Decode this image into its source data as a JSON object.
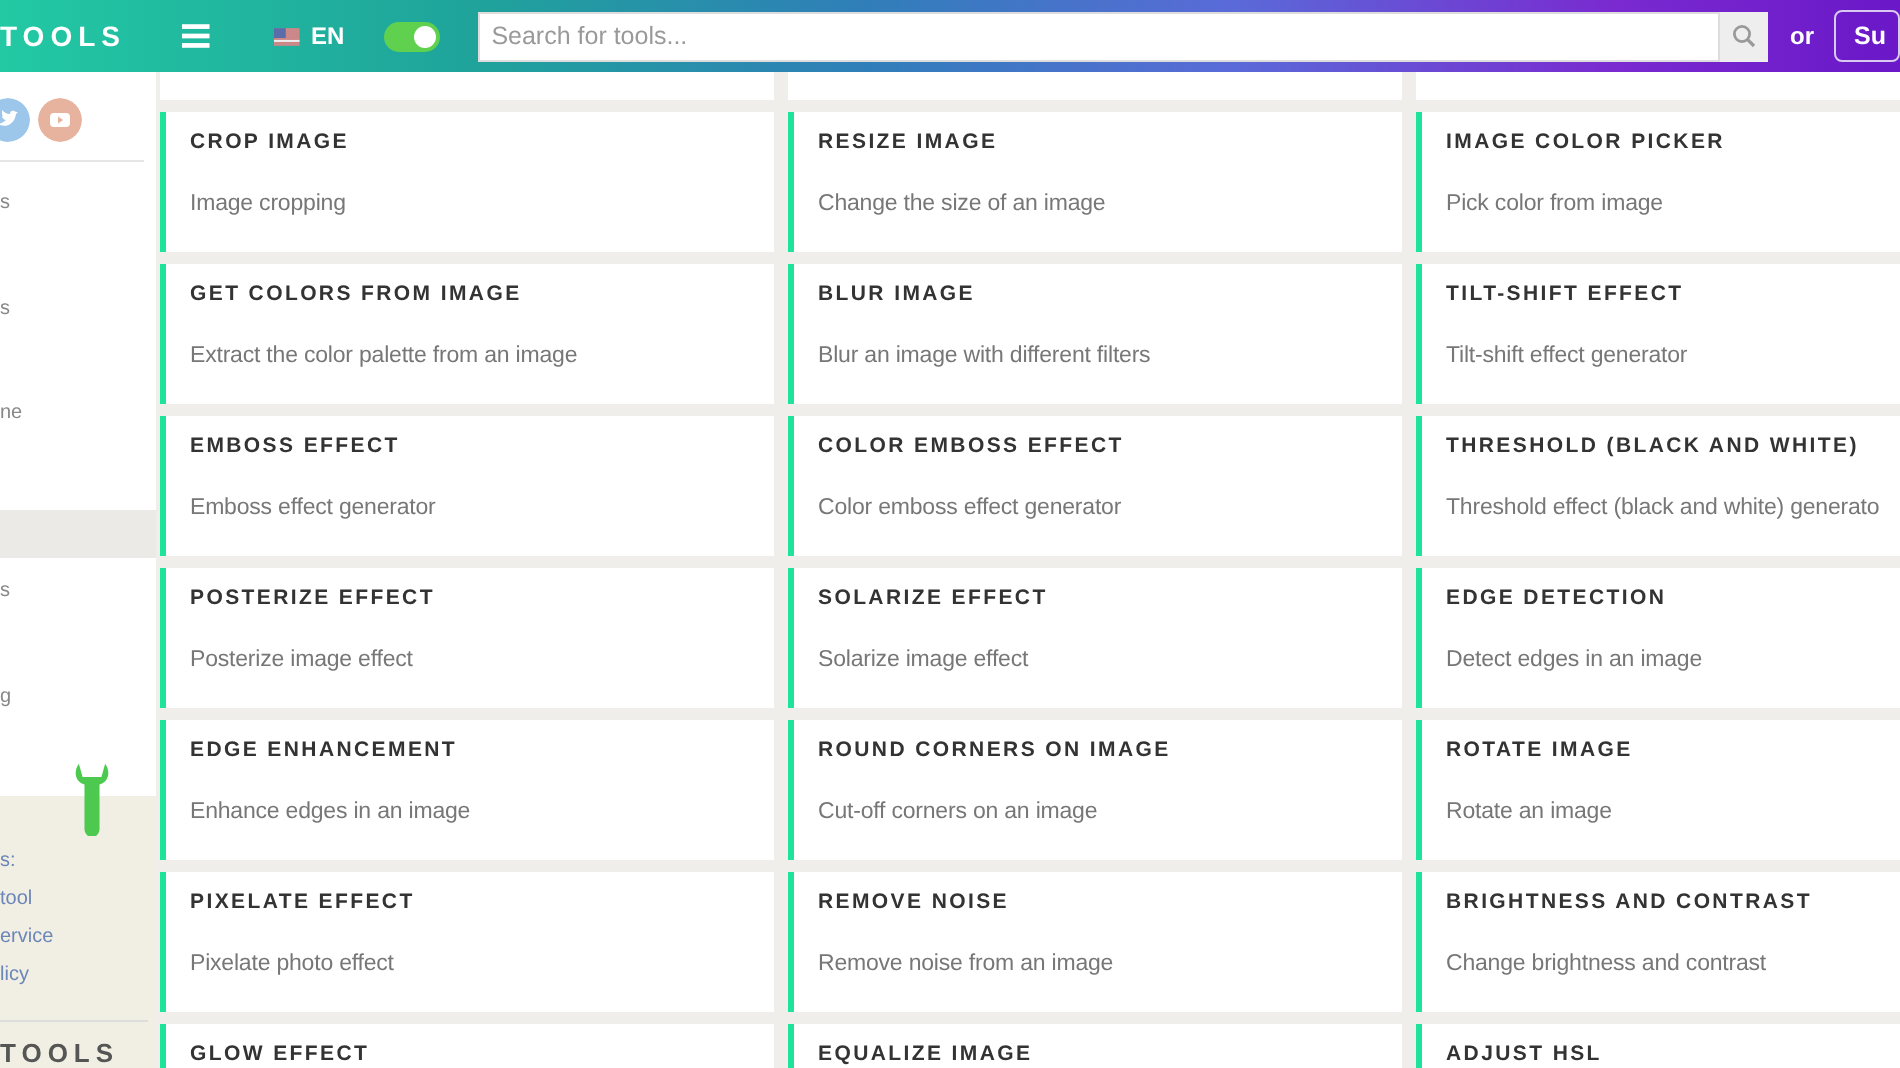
{
  "header": {
    "logo": "TOOLS",
    "language": "EN",
    "dark_mode": {
      "on": true
    },
    "search": {
      "placeholder": "Search for tools..."
    },
    "or_text": "or",
    "submit_label": "Su"
  },
  "sidebar": {
    "upper_items": [
      "s",
      "s",
      "ne"
    ],
    "lower_items": [
      "s",
      "g"
    ],
    "links": [
      "s:",
      "tool",
      "ervice",
      "licy"
    ],
    "footer_logo": "TOOLS"
  },
  "tools": [
    {
      "title": "CROP IMAGE",
      "description": "Image cropping"
    },
    {
      "title": "RESIZE IMAGE",
      "description": "Change the size of an image"
    },
    {
      "title": "IMAGE COLOR PICKER",
      "description": "Pick color from image"
    },
    {
      "title": "GET COLORS FROM IMAGE",
      "description": "Extract the color palette from an image"
    },
    {
      "title": "BLUR IMAGE",
      "description": "Blur an image with different filters"
    },
    {
      "title": "TILT-SHIFT EFFECT",
      "description": "Tilt-shift effect generator"
    },
    {
      "title": "EMBOSS EFFECT",
      "description": "Emboss effect generator"
    },
    {
      "title": "COLOR EMBOSS EFFECT",
      "description": "Color emboss effect generator"
    },
    {
      "title": "THRESHOLD (BLACK AND WHITE)",
      "description": "Threshold effect (black and white) generato"
    },
    {
      "title": "POSTERIZE EFFECT",
      "description": "Posterize image effect"
    },
    {
      "title": "SOLARIZE EFFECT",
      "description": "Solarize image effect"
    },
    {
      "title": "EDGE DETECTION",
      "description": "Detect edges in an image"
    },
    {
      "title": "EDGE ENHANCEMENT",
      "description": "Enhance edges in an image"
    },
    {
      "title": "ROUND CORNERS ON IMAGE",
      "description": "Cut-off corners on an image"
    },
    {
      "title": "ROTATE IMAGE",
      "description": "Rotate an image"
    },
    {
      "title": "PIXELATE EFFECT",
      "description": "Pixelate photo effect"
    },
    {
      "title": "REMOVE NOISE",
      "description": "Remove noise from an image"
    },
    {
      "title": "BRIGHTNESS AND CONTRAST",
      "description": "Change brightness and contrast"
    },
    {
      "title": "GLOW EFFECT"
    },
    {
      "title": "EQUALIZE IMAGE"
    },
    {
      "title": "ADJUST HSL"
    }
  ]
}
